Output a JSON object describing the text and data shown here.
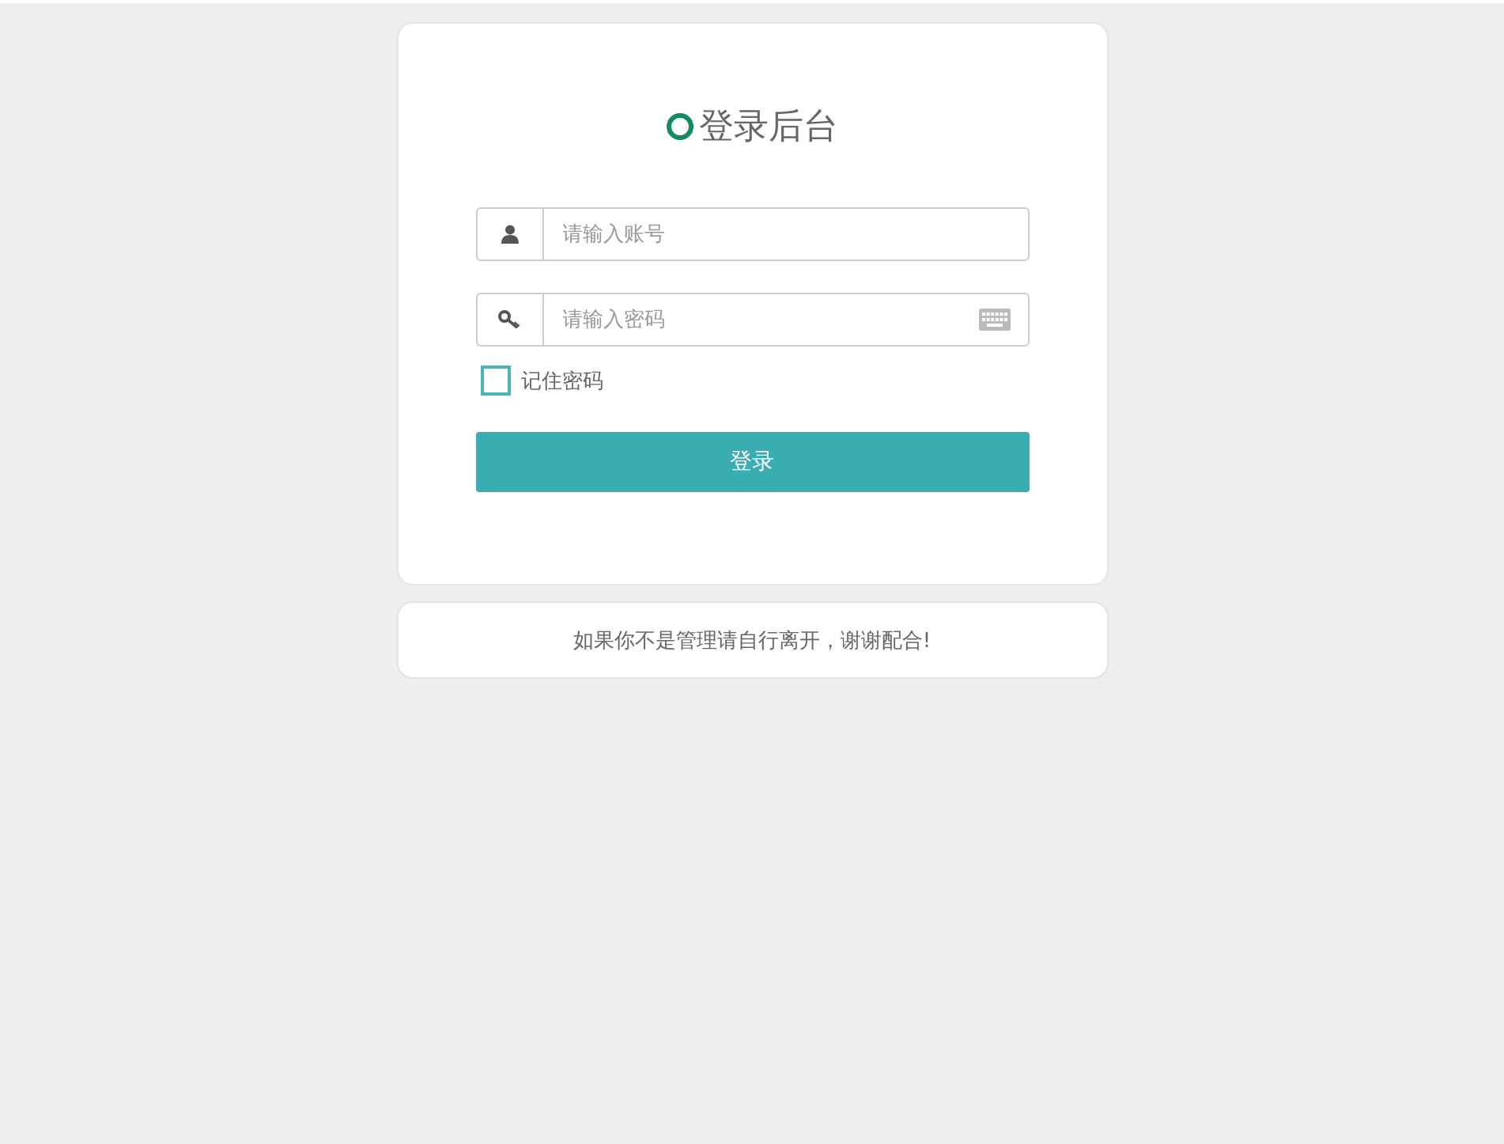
{
  "title": "登录后台",
  "fields": [
    {
      "kind": "user",
      "placeholder": "请输入账号"
    },
    {
      "kind": "password",
      "placeholder": "请输入密码"
    }
  ],
  "remember": {
    "label": "记住密码",
    "checked": false
  },
  "login_button": "登录",
  "footer": "如果你不是管理请自行离开，谢谢配合!"
}
